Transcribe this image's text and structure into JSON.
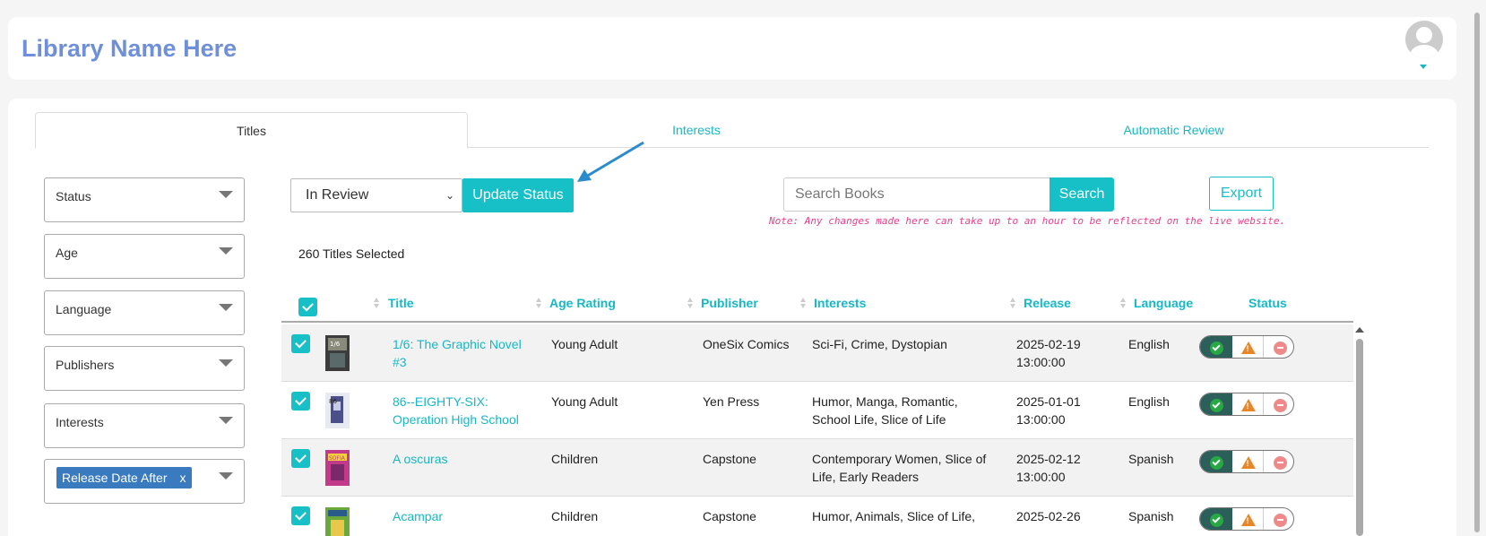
{
  "header": {
    "library_name": "Library Name Here"
  },
  "tabs": [
    {
      "label": "Titles"
    },
    {
      "label": "Interests"
    },
    {
      "label": "Automatic Review"
    }
  ],
  "filters": {
    "status": "Status",
    "age": "Age",
    "language": "Language",
    "publishers": "Publishers",
    "interests": "Interests",
    "release_chip": "Release Date After",
    "chip_remove": "x"
  },
  "toolbar": {
    "status_value": "In Review",
    "update_label": "Update Status",
    "search_placeholder": "Search Books",
    "search_label": "Search",
    "export_label": "Export",
    "note": "Note: Any changes made here can take up to an hour to be reflected on the live website.",
    "selected_count": "260 Titles Selected"
  },
  "table": {
    "columns": [
      "Title",
      "Age Rating",
      "Publisher",
      "Interests",
      "Release",
      "Language",
      "Status"
    ],
    "rows": [
      {
        "title_line1": "1/6: The Graphic Novel",
        "title_line2": "#3",
        "age": "Young Adult",
        "publisher": "OneSix Comics",
        "interests_line1": "Sci-Fi, Crime, Dystopian",
        "interests_line2": "",
        "release_date": "2025-02-19",
        "release_time": "13:00:00",
        "language": "English"
      },
      {
        "title_line1": "86--EIGHTY-SIX:",
        "title_line2": "Operation High School",
        "age": "Young Adult",
        "publisher": "Yen Press",
        "interests_line1": "Humor, Manga, Romantic,",
        "interests_line2": "School Life, Slice of Life",
        "release_date": "2025-01-01",
        "release_time": "13:00:00",
        "language": "English"
      },
      {
        "title_line1": "A oscuras",
        "title_line2": "",
        "age": "Children",
        "publisher": "Capstone",
        "interests_line1": "Contemporary Women, Slice of",
        "interests_line2": "Life, Early Readers",
        "release_date": "2025-02-12",
        "release_time": "13:00:00",
        "language": "Spanish"
      },
      {
        "title_line1": "Acampar",
        "title_line2": "",
        "age": "Children",
        "publisher": "Capstone",
        "interests_line1": "Humor, Animals, Slice of Life,",
        "interests_line2": "",
        "release_date": "2025-02-26",
        "release_time": "",
        "language": "Spanish"
      }
    ]
  },
  "colors": {
    "accent": "#17bfc6",
    "title": "#6f8fd8",
    "note": "#e83e8c",
    "chip": "#3a7abe"
  }
}
